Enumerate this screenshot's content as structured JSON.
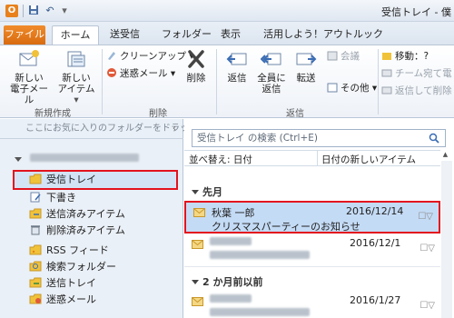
{
  "window": {
    "title": "受信トレイ - 僕",
    "app_logo": "O",
    "quick_access": {
      "save_icon": "save-icon",
      "undo_icon": "undo-icon",
      "customize_icon": "customize-icon"
    }
  },
  "tabs": [
    {
      "label": "ファイル"
    },
    {
      "label": "ホーム"
    },
    {
      "label": "送受信"
    },
    {
      "label": "フォルダー"
    },
    {
      "label": "表示"
    },
    {
      "label": "活用しよう！アウトルック"
    }
  ],
  "ribbon": {
    "groups": {
      "new": {
        "label": "新規作成",
        "new_email": "新しい\n電子メール",
        "new_items": "新しい\nアイテム"
      },
      "delete": {
        "label": "削除",
        "cleanup": "クリーンアップ",
        "junk": "迷惑メール",
        "delete_btn": "削除"
      },
      "respond": {
        "label": "返信",
        "reply": "返信",
        "reply_all": "全員に\n返信",
        "forward": "転送",
        "meeting": "会議",
        "more": "その他"
      },
      "quicksteps": {
        "move": "移動：?",
        "team_email": "チーム宛て電",
        "reply_delete": "返信して削除"
      }
    }
  },
  "nav": {
    "hint": "ここにお気に入りのフォルダーをドラッグ",
    "hint_arrow": "‹",
    "folders": [
      {
        "label": "受信トレイ",
        "icon": "inbox-folder-icon"
      },
      {
        "label": "下書き",
        "icon": "drafts-icon"
      },
      {
        "label": "送信済みアイテム",
        "icon": "sent-items-icon"
      },
      {
        "label": "削除済みアイテム",
        "icon": "deleted-items-icon"
      },
      {
        "label": "RSS フィード",
        "icon": "rss-icon"
      },
      {
        "label": "検索フォルダー",
        "icon": "search-folder-icon"
      },
      {
        "label": "送信トレイ",
        "icon": "outbox-icon"
      },
      {
        "label": "迷惑メール",
        "icon": "junk-folder-icon"
      }
    ]
  },
  "mail_list": {
    "search_placeholder": "受信トレイ の検索 (Ctrl+E)",
    "sort_label": "並べ替え: 日付",
    "order_label": "日付の新しいアイテム",
    "groups": [
      {
        "title": "先月"
      },
      {
        "title": "2 か月前以前"
      }
    ],
    "items": [
      {
        "sender": "秋葉 一郎",
        "date": "2016/12/14",
        "subject": "クリスマスパーティーのお知らせ",
        "selected": true
      },
      {
        "sender": "",
        "date": "2016/12/1",
        "subject": "",
        "selected": false
      },
      {
        "sender": "",
        "date": "2016/1/27",
        "subject": "",
        "selected": false
      }
    ]
  },
  "colors": {
    "accent": "#e3131e",
    "file_tab": "#e8811c",
    "selection": "#c4dbf5"
  }
}
